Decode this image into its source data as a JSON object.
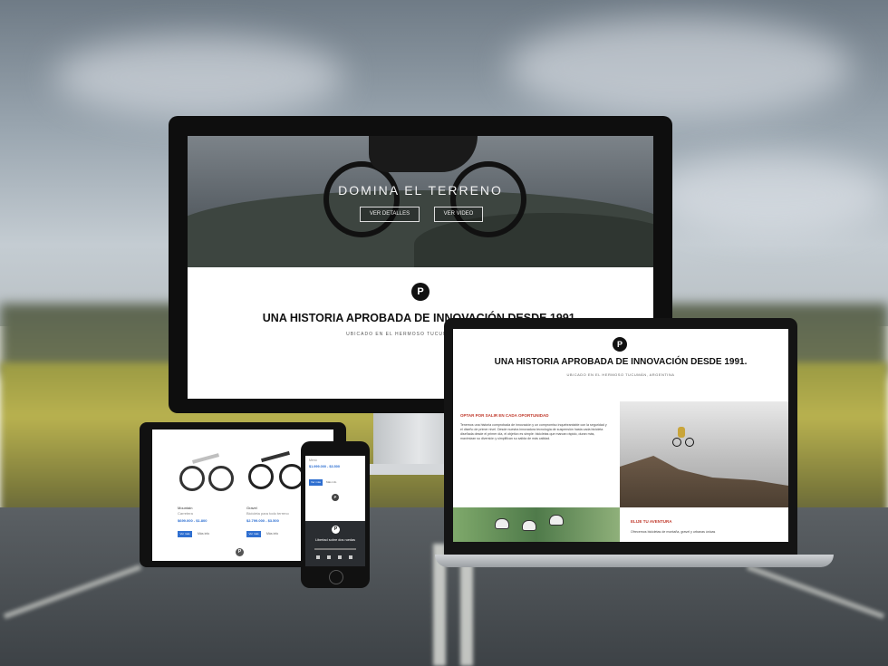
{
  "desktop": {
    "hero_title": "DOMINA EL TERRENO",
    "hero_buttons": [
      "VER DETALLES",
      "VER VIDEO"
    ],
    "logo_letter": "P",
    "heading": "UNA HISTORIA APROBADA DE INNOVACIÓN DESDE 1991.",
    "subheading": "UBICADO EN EL HERMOSO TUCUMÁN, ARGENTINA"
  },
  "laptop": {
    "logo_letter": "P",
    "heading": "UNA HISTORIA APROBADA DE INNOVACIÓN DESDE 1991.",
    "subheading": "UBICADO EN EL HERMOSO TUCUMÁN, ARGENTINA",
    "section1_title": "OPTAR POR SALIR EN CADA OPORTUNIDAD",
    "section1_body": "Tenemos una historia comprobada de innovación y un compromiso inquebrantable con la seguridad y el diseño de primer nivel. Desde nuestra innovadora tecnología de suspensión hasta cada bicicleta diseñada desde el primer día, el objetivo es simple: bicicletas que marcan rápido, duran más, maximizan su diversión y simplifican su salida de más calidad.",
    "section2_title": "ELIJE TU AVENTURA",
    "section2_body": "Ofrecemos bicicletas de montaña, gravel y urbanas únicas"
  },
  "tablet": {
    "products": [
      {
        "name": "Mountain",
        "tag": "Carretera",
        "price": "$699.000 - $1.800",
        "buy": "Ver más",
        "more": "Más info"
      },
      {
        "name": "Gravel",
        "tag": "Bicicleta para todo terreno",
        "price": "$2.799.000 - $3.500",
        "buy": "Ver más",
        "more": "Más info"
      }
    ],
    "logo_letter": "P"
  },
  "phone": {
    "nav": "Menú",
    "price": "$1.999.000 - $3.500",
    "button": "Ver más",
    "link": "Más info",
    "logo_letter": "P",
    "tagline": "Libertad sobre dos ruedas"
  }
}
